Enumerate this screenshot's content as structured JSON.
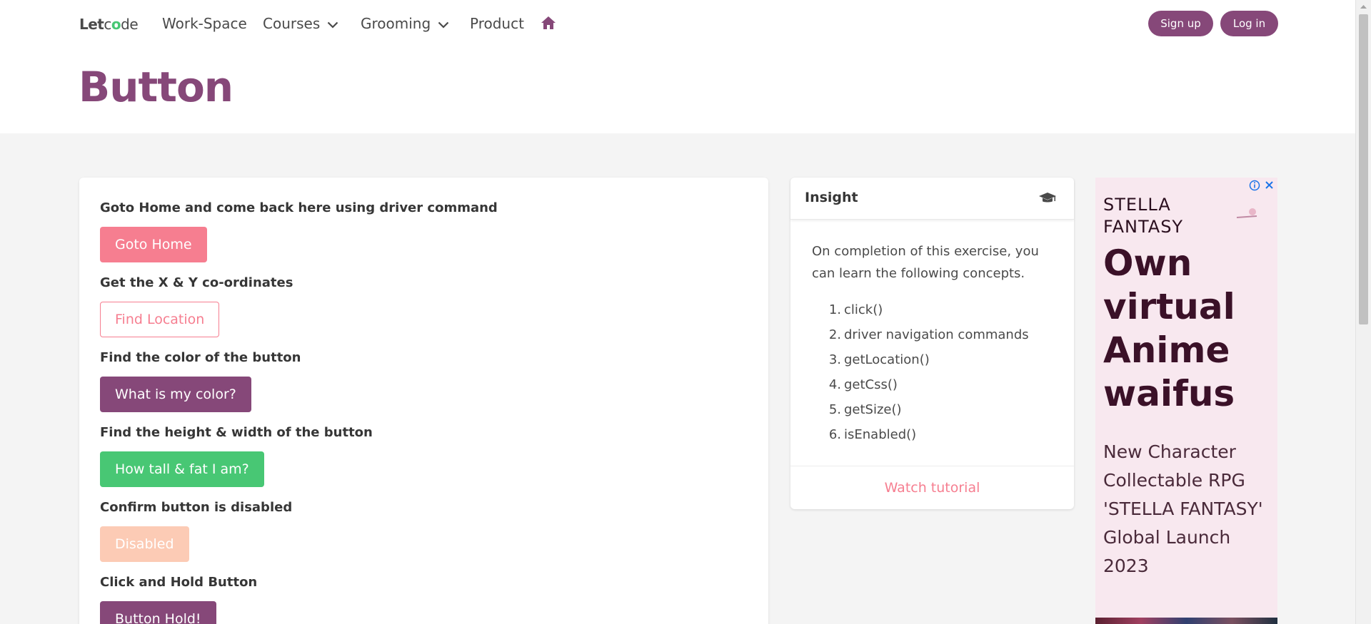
{
  "nav": {
    "logo": {
      "prefix": "Let",
      "o": "o",
      "c": "c",
      "suffix": "de"
    },
    "items": [
      "Work-Space",
      "Courses",
      "Grooming",
      "Product"
    ],
    "signup": "Sign up",
    "login": "Log in"
  },
  "page": {
    "title": "Button"
  },
  "exercises": [
    {
      "label": "Goto Home and come back here using driver command",
      "button": "Goto Home"
    },
    {
      "label": "Get the X & Y co-ordinates",
      "button": "Find Location"
    },
    {
      "label": "Find the color of the button",
      "button": "What is my color?"
    },
    {
      "label": "Find the height & width of the button",
      "button": "How tall & fat I am?"
    },
    {
      "label": "Confirm button is disabled",
      "button": "Disabled"
    },
    {
      "label": "Click and Hold Button",
      "button": "Button Hold!"
    }
  ],
  "insight": {
    "title": "Insight",
    "text": "On completion of this exercise, you can learn the following concepts.",
    "concepts": [
      "click()",
      "driver navigation commands",
      "getLocation()",
      "getCss()",
      "getSize()",
      "isEnabled()"
    ],
    "footer": "Watch tutorial"
  },
  "ad": {
    "brand_line1": "STELLA",
    "brand_line2": "FANTASY",
    "headline": "Own virtual Anime waifus",
    "sub": "New Character Collectable RPG 'STELLA FANTASY' Global Launch 2023"
  },
  "colors": {
    "brand": "#864879",
    "accent": "#f67e90",
    "success": "#48c774"
  }
}
